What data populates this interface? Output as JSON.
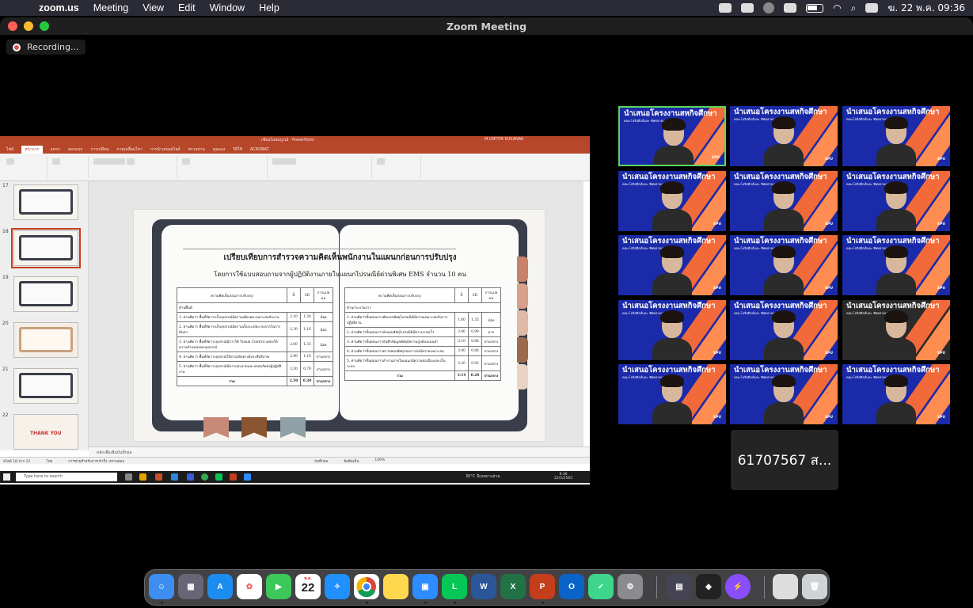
{
  "menubar": {
    "app": "zoom.us",
    "items": [
      "Meeting",
      "View",
      "Edit",
      "Window",
      "Help"
    ],
    "datetime": "ฆ. 22 พ.ค.  09:36"
  },
  "window": {
    "title": "Zoom Meeting",
    "recording": "Recording..."
  },
  "ppt": {
    "title": "เขียนไม่สมบูรณ์ - PowerPoint",
    "user": "M.UNTITA KUSANAK",
    "tabs": [
      "ไฟล์",
      "หน้าแรก",
      "แทรก",
      "ออกแบบ",
      "การเปลี่ยน",
      "ภาพเคลื่อนไหว",
      "การนำเสนอสไลด์",
      "ตรวจทาน",
      "มุมมอง",
      "วิธีใช้",
      "ACROBAT"
    ],
    "thumb_numbers": [
      "17",
      "18",
      "19",
      "20",
      "21",
      "22"
    ],
    "thumb_thank_you": "THANK YOU",
    "notes": "คลิกเพื่อเพิ่มบันทึกย่อ",
    "status": [
      "สไลด์ 18 จาก 22",
      "ไทย",
      "การช่วยสำหรับการเข้าถึง: ตรวจสอบ",
      "บันทึกย่อ",
      "ข้อคิดเห็น",
      "140%"
    ]
  },
  "slide": {
    "title": "เปรียบเทียบการสำรวจความคิดเห็นพนักงานในแผนกก่อนการปรับปรุง",
    "subtitle": "โดยการใช้แบบสอบถามจากผู้ปฏิบัติงานภายในแผนกไปรษณีย์ด่วนพิเศษ EMS จำนวน 10 คน",
    "left_table": {
      "headers": [
        "ความคิดเห็นก่อนการปรับปรุง",
        "X̄",
        "SD",
        "การแปลผล"
      ],
      "section": "ด้านพื้นที่",
      "rows": [
        [
          "1. ท่านคิดว่า พื้นที่จัดวางเก็บอุปกรณ์มีความเพียงพอ เหมาะสมกับงาน",
          "2.10",
          "1.20",
          "น้อย"
        ],
        [
          "2. ท่านคิดว่า พื้นที่จัดวางเก็บอุปกรณ์มีความเป็นระเบียบ สะดวกในการค้นหา",
          "2.30",
          "1.16",
          "น้อย"
        ],
        [
          "3. ท่านคิดว่า พื้นที่จัดวางอุปกรณ์มีการใช้ Visual Control แสดงให้ทราบตำแหน่งของอุปกรณ์",
          "2.00",
          "1.33",
          "น้อย"
        ],
        [
          "4. ท่านคิดว่า พื้นที่จัดวางอุปกรณ์ใช้งานได้อย่างมีประสิทธิภาพ",
          "2.90",
          "1.10",
          "ปานกลาง"
        ],
        [
          "5. ท่านคิดว่า พื้นที่จัดวางอุปกรณ์มีความสะอาดและปลอดภัยต่อผู้ปฏิบัติงาน",
          "3.30",
          "0.79",
          "ปานกลาง"
        ]
      ],
      "total": [
        "รวม",
        "2.50",
        "0.20",
        "ปานกลาง"
      ]
    },
    "right_table": {
      "headers": [
        "ความคิดเห็นก่อนการปรับปรุง",
        "X̄",
        "SD",
        "การแปลผล"
      ],
      "section": "ด้านกระบวนการ",
      "rows": [
        [
          "1. ท่านคิดว่าขั้นตอนการคัดแยกพัสดุไปรษณีย์มีความเหมาะสมกับการปฏิบัติงาน",
          "1.60",
          "1.35",
          "น้อย"
        ],
        [
          "2. ท่านคิดว่าขั้นตอนการส่งมอบพัสดุไปรษณีย์มีความรวดเร็ว",
          "3.90",
          "0.99",
          "มาก"
        ],
        [
          "3. ท่านคิดว่าขั้นตอนการบันทึกข้อมูลพัสดุมีความถูกต้องแม่นยำ",
          "3.10",
          "0.88",
          "ปานกลาง"
        ],
        [
          "4. ท่านคิดว่าขั้นตอนการตรวจสอบพัสดุก่อนการส่งมีความเหมาะสม",
          "3.90",
          "0.88",
          "ปานกลาง"
        ],
        [
          "5. ท่านคิดว่าขั้นตอนการทำงานภายในแผนกมีความต่อเนื่องและเป็นระบบ",
          "3.20",
          "0.92",
          "ปานกลาง"
        ]
      ],
      "total": [
        "รวม",
        "3.14",
        "0.20",
        "ปานกลาง"
      ]
    }
  },
  "taskbar": {
    "search": "Type here to search",
    "weather": "30°C  มีเมฆบางส่วน",
    "time": "9:36",
    "date": "22/5/2565"
  },
  "participants": {
    "banner": "นำเสนอโครงงานสหกิจศึกษา",
    "banner_sub": "คณะโลจิสติกส์และ ซัพพลายเชน",
    "brand": "SPU",
    "name_tile": "61707567 ส..."
  },
  "dock": {
    "cal_month": "พ.ค.",
    "cal_day": "22"
  },
  "colors": {
    "ppt_red": "#b7472a",
    "zoom_tile_blue": "#1a2aa8",
    "tile_orange": "#f26a3a",
    "active_speaker": "#5bd65b"
  }
}
